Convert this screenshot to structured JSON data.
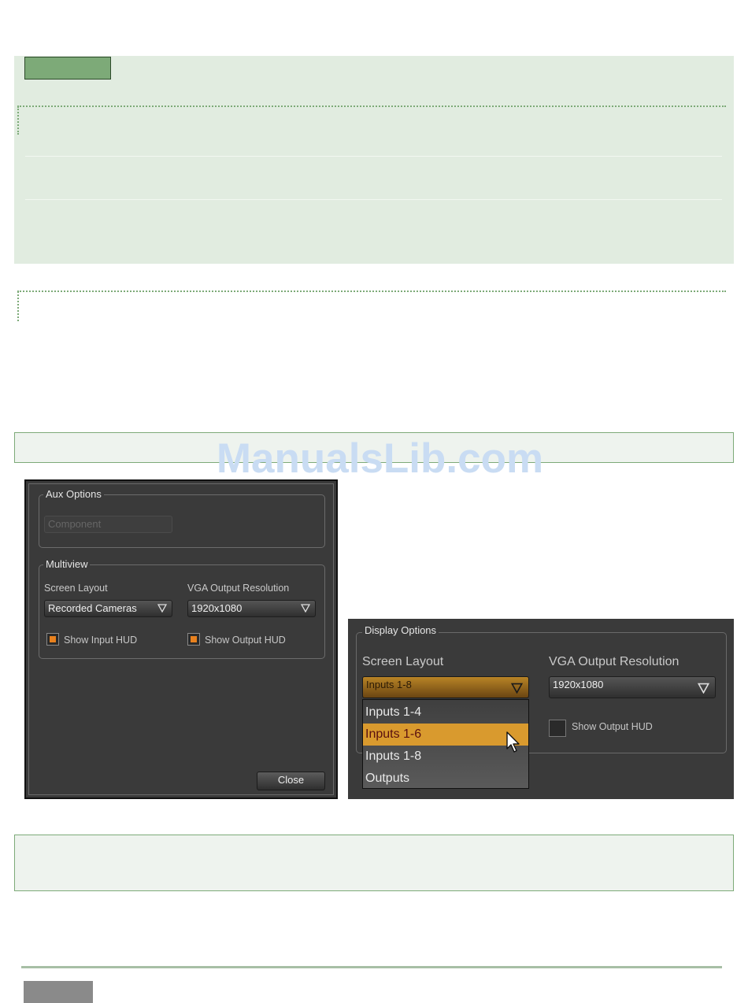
{
  "watermark": "ManualsLib.com",
  "dialog": {
    "aux_group": "Aux Options",
    "aux_value": "Component",
    "multiview_group": "Multiview",
    "screen_layout_label": "Screen Layout",
    "screen_layout_value": "Recorded Cameras",
    "vga_label": "VGA Output Resolution",
    "vga_value": "1920x1080",
    "show_input_hud": "Show Input HUD",
    "show_output_hud": "Show Output HUD",
    "close": "Close"
  },
  "zoom": {
    "group": "Display Options",
    "screen_layout_label": "Screen Layout",
    "screen_layout_value": "Inputs 1-8",
    "vga_label": "VGA Output Resolution",
    "vga_value": "1920x1080",
    "show_output_hud": "Show Output HUD",
    "options": [
      "Inputs 1-4",
      "Inputs 1-6",
      "Inputs 1-8",
      "Outputs"
    ],
    "selected_index": 1
  },
  "colors": {
    "note_green": "#7daa78",
    "note_bg": "#e1ece0",
    "accent_orange": "#e8811e",
    "highlight": "#d99a2e"
  }
}
